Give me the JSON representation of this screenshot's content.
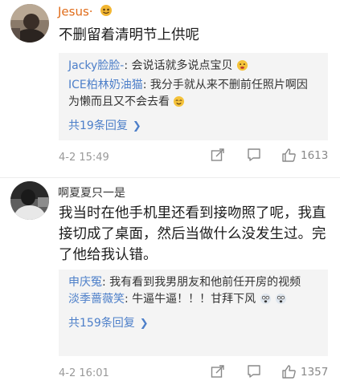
{
  "comments": [
    {
      "username": "Jesus·",
      "text": "不删留着清明节上供呢",
      "replies": [
        {
          "name": "Jacky脸脸-",
          "text": ": 会说话就多说点宝贝"
        },
        {
          "name": "ICE柏林奶油猫",
          "text": ": 我分手就从来不删前任照片啊因为懒而且又不会去看"
        }
      ],
      "more_label": "共19条回复",
      "timestamp": "4-2 15:49",
      "like_count": "1613"
    },
    {
      "username": "啊夏夏只一是",
      "text": "我当时在他手机里还看到接吻照了呢，我直接切成了桌面，然后当做什么没发生过。完了他给我认错。",
      "replies": [
        {
          "name": "申庆冤",
          "text": ": 我有看到我男朋友和他前任开房的视频"
        },
        {
          "name": "淡季蔷薇笑",
          "text": ": 牛逼牛逼！！！甘拜下风"
        }
      ],
      "more_label": "共159条回复",
      "timestamp": "4-2 16:01",
      "like_count": "1357"
    }
  ],
  "colors": {
    "username_orange": "#e06c1a",
    "link_blue": "#4d7fc9",
    "meta_gray": "#999999",
    "reply_bg": "#f4f4f4"
  },
  "icons": [
    "share-icon",
    "comment-icon",
    "thumbs-up-icon",
    "emoji-icon",
    "member-badge-icon"
  ]
}
